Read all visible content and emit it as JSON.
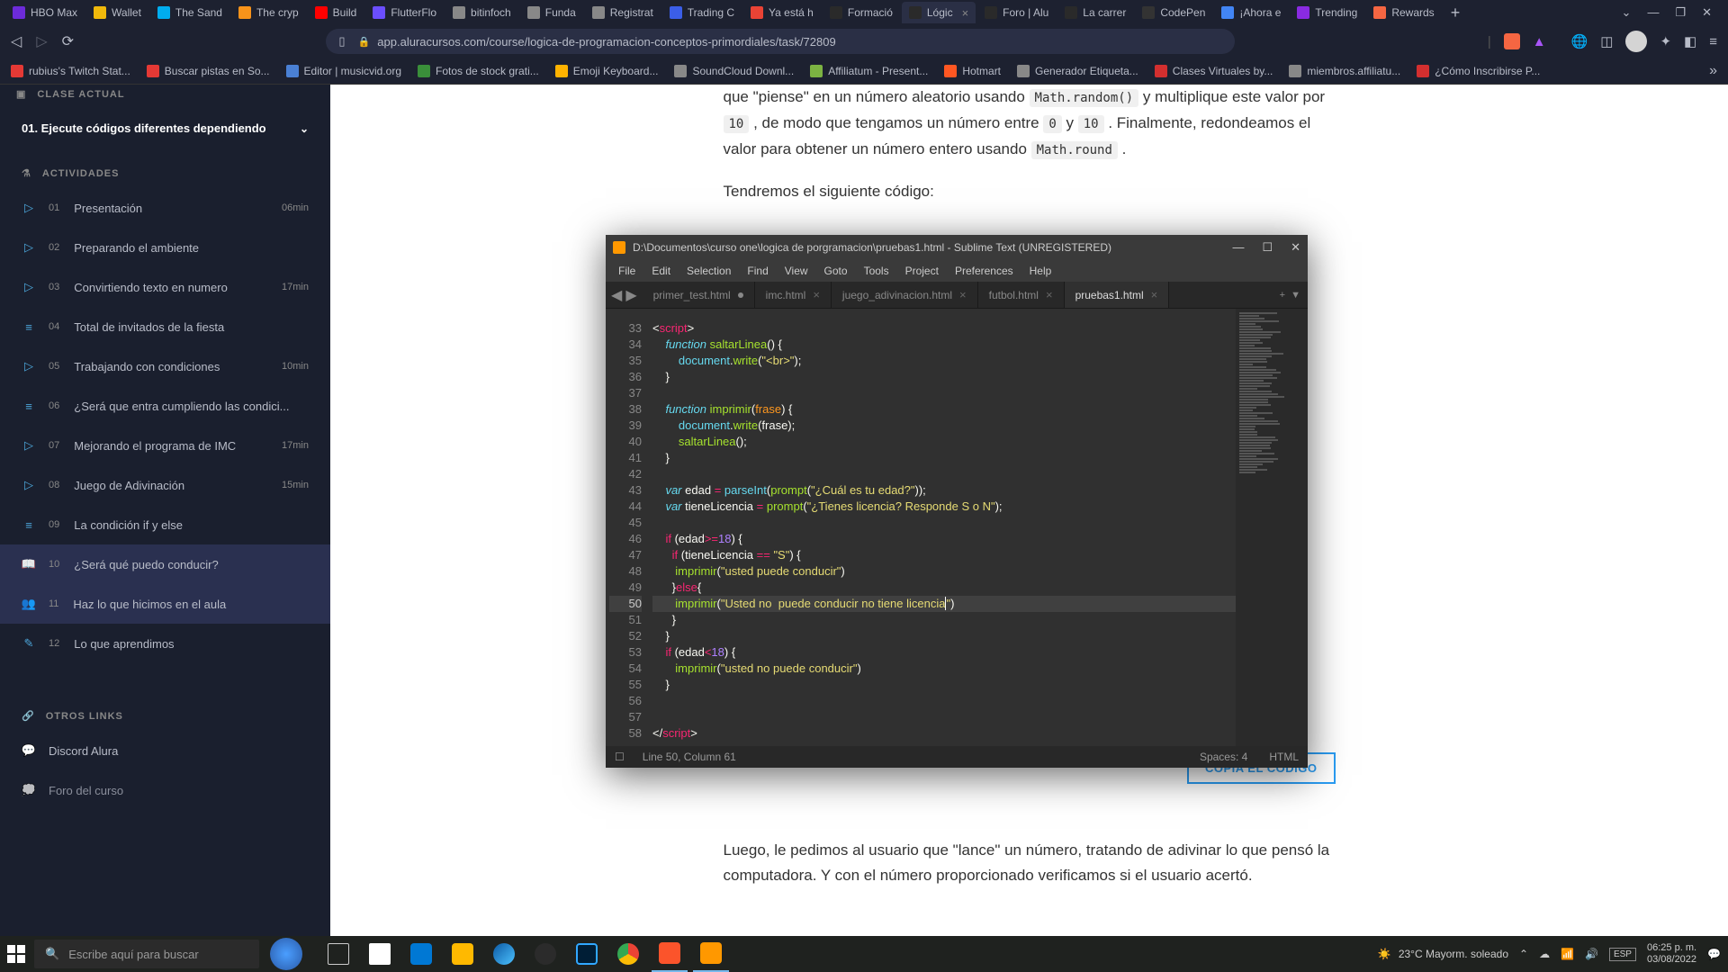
{
  "browser_tabs": [
    {
      "label": "HBO Max",
      "fav": "#6c2bd9"
    },
    {
      "label": "Wallet",
      "fav": "#f0b90b"
    },
    {
      "label": "The Sand",
      "fav": "#00adef"
    },
    {
      "label": "The cryp",
      "fav": "#f7931a"
    },
    {
      "label": "Build",
      "fav": "#ff0000"
    },
    {
      "label": "FlutterFlo",
      "fav": "#6b4eff"
    },
    {
      "label": "bitinfoch",
      "fav": "#888"
    },
    {
      "label": "Funda",
      "fav": "#888"
    },
    {
      "label": "Registrat",
      "fav": "#888"
    },
    {
      "label": "Trading C",
      "fav": "#3b5ee8"
    },
    {
      "label": "Ya está h",
      "fav": "#ea4335"
    },
    {
      "label": "Formació",
      "fav": "#2a2a2a",
      "aicon": true
    },
    {
      "label": "Lógic",
      "fav": "#2a2a2a",
      "active": true,
      "aicon": true
    },
    {
      "label": "Foro | Alu",
      "fav": "#2a2a2a",
      "aicon": true
    },
    {
      "label": "La carrer",
      "fav": "#2a2a2a",
      "aicon": true
    },
    {
      "label": "CodePen",
      "fav": "#333"
    },
    {
      "label": "¡Ahora e",
      "fav": "#4285f4"
    },
    {
      "label": "Trending",
      "fav": "#8a2be2"
    },
    {
      "label": "Rewards",
      "fav": "#f56642"
    }
  ],
  "url": "app.aluracursos.com/course/logica-de-programacion-conceptos-primordiales/task/72809",
  "bookmarks": [
    {
      "label": "rubius's Twitch Stat...",
      "c": "#e53935"
    },
    {
      "label": "Buscar pistas en So...",
      "c": "#e53935"
    },
    {
      "label": "Editor | musicvid.org",
      "c": "#4a80d4"
    },
    {
      "label": "Fotos de stock grati...",
      "c": "#3a8f3a"
    },
    {
      "label": "Emoji Keyboard...",
      "c": "#ffb300"
    },
    {
      "label": "SoundCloud Downl...",
      "c": "#888"
    },
    {
      "label": "Affiliatum - Present...",
      "c": "#7cb342"
    },
    {
      "label": "Hotmart",
      "c": "#ff5722"
    },
    {
      "label": "Generador Etiqueta...",
      "c": "#888"
    },
    {
      "label": "Clases Virtuales by...",
      "c": "#d32f2f"
    },
    {
      "label": "miembros.affiliatu...",
      "c": "#888"
    },
    {
      "label": "¿Cómo Inscribirse P...",
      "c": "#d32f2f"
    }
  ],
  "sidebar": {
    "clase": "CLASE ACTUAL",
    "current": "01. Ejecute códigos diferentes dependiendo",
    "act_label": "ACTIVIDADES",
    "items": [
      {
        "n": "01",
        "t": "Presentación",
        "d": "06min",
        "ic": "▷"
      },
      {
        "n": "02",
        "t": "Preparando el ambiente",
        "d": "",
        "ic": "▷"
      },
      {
        "n": "03",
        "t": "Convirtiendo texto en numero",
        "d": "17min",
        "ic": "▷"
      },
      {
        "n": "04",
        "t": "Total de invitados de la fiesta",
        "d": "",
        "ic": "≡"
      },
      {
        "n": "05",
        "t": "Trabajando con condiciones",
        "d": "10min",
        "ic": "▷"
      },
      {
        "n": "06",
        "t": "¿Será que entra cumpliendo las condici...",
        "d": "",
        "ic": "≡"
      },
      {
        "n": "07",
        "t": "Mejorando el programa de IMC",
        "d": "17min",
        "ic": "▷"
      },
      {
        "n": "08",
        "t": "Juego de Adivinación",
        "d": "15min",
        "ic": "▷"
      },
      {
        "n": "09",
        "t": "La condición if y else",
        "d": "",
        "ic": "≡"
      },
      {
        "n": "10",
        "t": "¿Será qué puedo conducir?",
        "d": "",
        "ic": "📖",
        "active": true
      },
      {
        "n": "11",
        "t": "Haz lo que hicimos en el aula",
        "d": "",
        "ic": "👥",
        "hl": true
      },
      {
        "n": "12",
        "t": "Lo que aprendimos",
        "d": "",
        "ic": "✎"
      }
    ],
    "otros": "OTROS LINKS",
    "discord": "Discord Alura",
    "foro": "Foro del curso"
  },
  "content": {
    "p1a": "que \"piense\" en un número aleatorio usando ",
    "c1": "Math.random()",
    "p1b": " y multiplique este valor por ",
    "c2": "10",
    "p1c": " , de modo que tengamos un número entre ",
    "c3": "0",
    "p1d": " y ",
    "c4": "10",
    "p1e": " . Finalmente, redondeamos el valor para obtener un número entero usando ",
    "c5": "Math.round",
    "p1f": " .",
    "p2": "Tendremos el siguiente código:",
    "copy": "COPIA EL CÓDIGO",
    "p3": "Luego, le pedimos al usuario que \"lance\" un número, tratando de adivinar lo que pensó la computadora. Y con el número proporcionado verificamos si el usuario acertó."
  },
  "sublime": {
    "title": "D:\\Documentos\\curso one\\logica de porgramacion\\pruebas1.html - Sublime Text (UNREGISTERED)",
    "menu": [
      "File",
      "Edit",
      "Selection",
      "Find",
      "View",
      "Goto",
      "Tools",
      "Project",
      "Preferences",
      "Help"
    ],
    "tabs": [
      {
        "name": "primer_test.html",
        "dirty": true
      },
      {
        "name": "imc.html"
      },
      {
        "name": "juego_adivinacion.html"
      },
      {
        "name": "futbol.html"
      },
      {
        "name": "pruebas1.html",
        "active": true
      }
    ],
    "lines_start": 33,
    "highlight_line": 50,
    "status": {
      "pos": "Line 50, Column 61",
      "spaces": "Spaces: 4",
      "lang": "HTML"
    }
  },
  "taskbar": {
    "search_placeholder": "Escribe aquí para buscar",
    "weather": "23°C  Mayorm. soleado",
    "time": "06:25 p. m.",
    "date": "03/08/2022"
  }
}
